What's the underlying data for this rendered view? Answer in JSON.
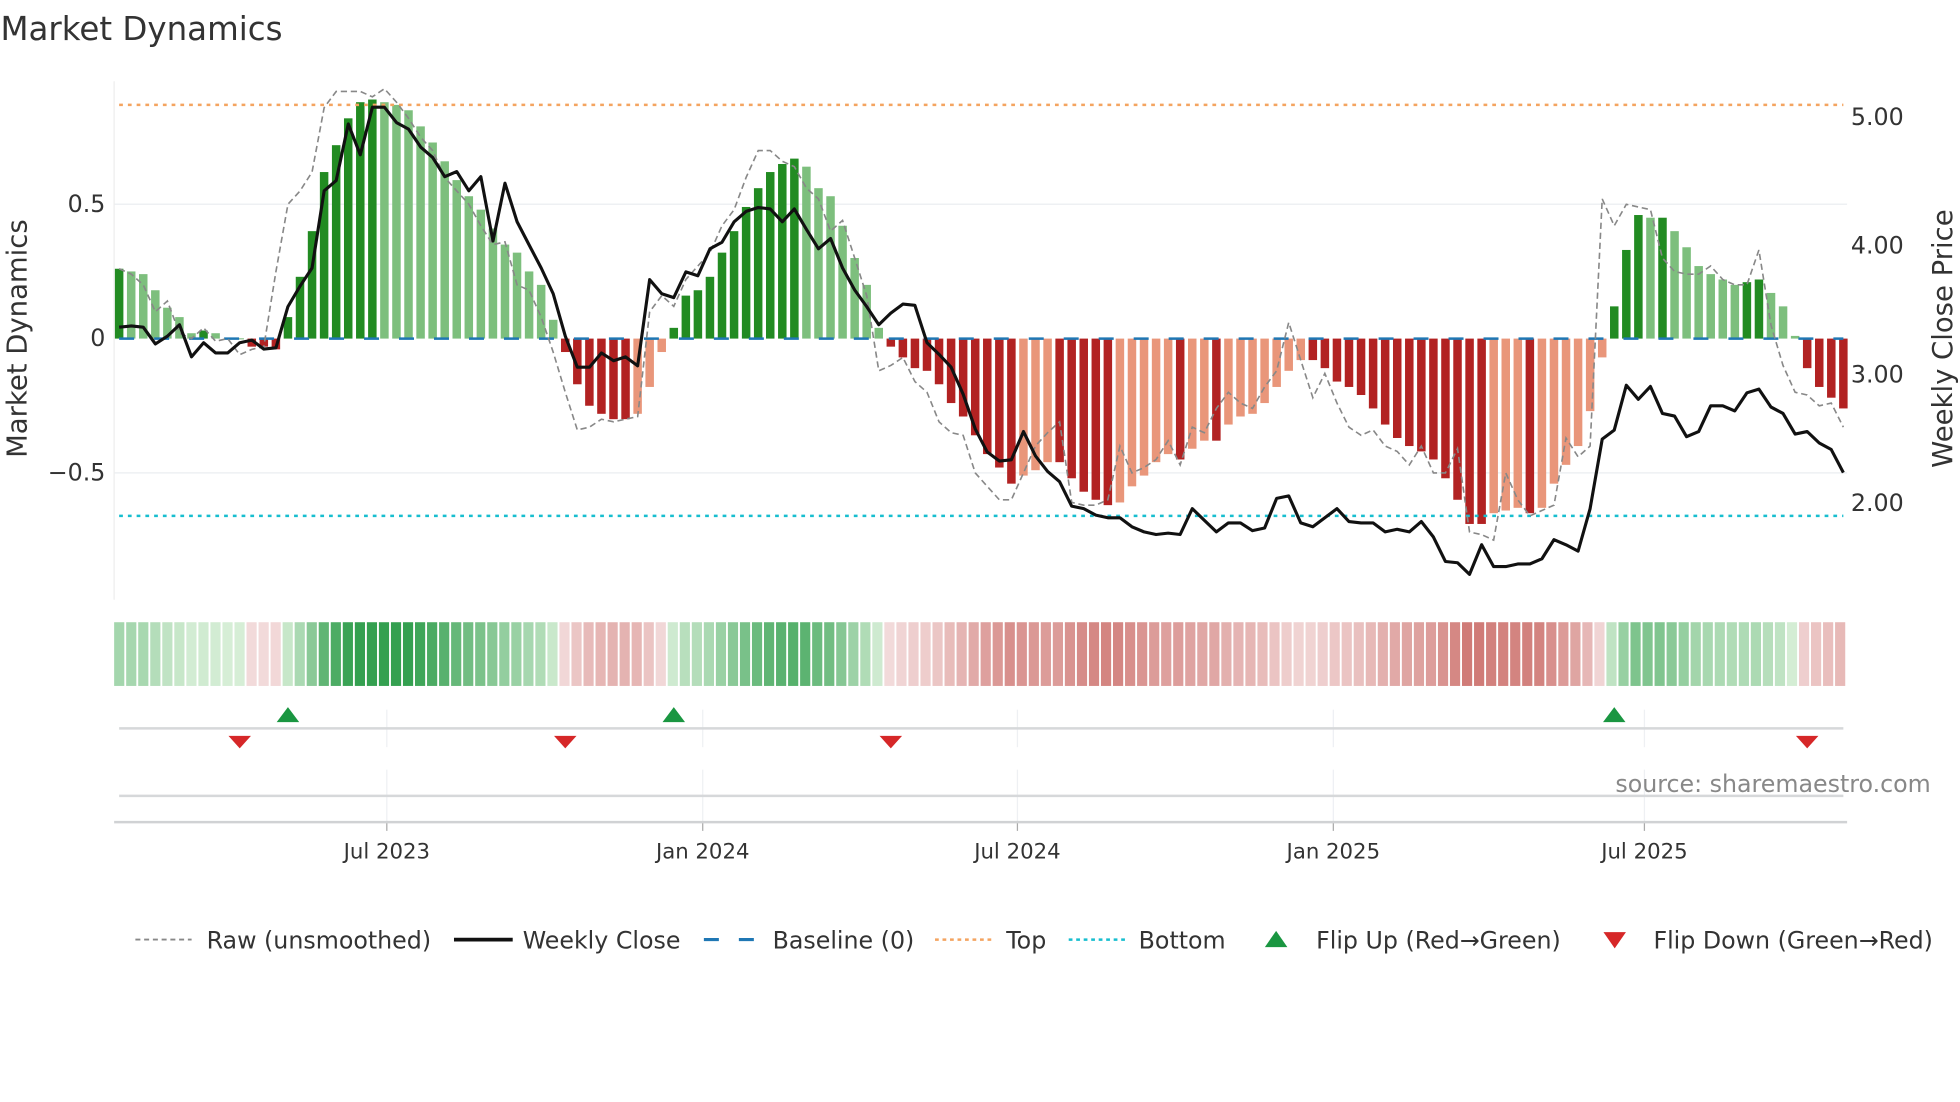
{
  "title": "Market Dynamics",
  "source": "source: sharemaestro.com",
  "colors": {
    "dark_green": "#228B22",
    "light_green": "#7DBF7D",
    "dark_red": "#B22222",
    "light_red": "#E9967A",
    "raw": "#888888",
    "close": "#111111",
    "baseline": "#1f77b4",
    "top": "#F4A460",
    "bottom": "#17BECF",
    "flip_up": "#1a9641",
    "flip_down": "#d62728"
  },
  "chart_data": {
    "type": "bar",
    "title": "Market Dynamics",
    "ylabel": "Market Dynamics",
    "y2label": "Weekly Close Price",
    "ylim": [
      -0.97,
      0.96
    ],
    "y2lim": [
      1.3,
      5.2
    ],
    "yticks": [
      {
        "value": 0.5,
        "label": "0.5"
      },
      {
        "value": 0,
        "label": "0"
      },
      {
        "value": -0.5,
        "label": "−0.5"
      }
    ],
    "y2ticks": [
      {
        "value": 5,
        "label": "5.00"
      },
      {
        "value": 4,
        "label": "4.00"
      },
      {
        "value": 3,
        "label": "3.00"
      },
      {
        "value": 2,
        "label": "2.00"
      }
    ],
    "xticks": [
      {
        "week": 22.2,
        "label": "Jul 2023"
      },
      {
        "week": 48.4,
        "label": "Jan 2024"
      },
      {
        "week": 74.5,
        "label": "Jul 2024"
      },
      {
        "week": 100.7,
        "label": "Jan 2025"
      },
      {
        "week": 126.5,
        "label": "Jul 2025"
      }
    ],
    "top_level": 0.87,
    "bottom_level": -0.66,
    "baseline": 0,
    "dynamics": [
      0.26,
      0.25,
      0.24,
      0.18,
      0.115,
      0.08,
      0.02,
      0.03,
      0.02,
      0.0,
      0.0,
      -0.03,
      -0.03,
      -0.04,
      0.08,
      0.23,
      0.4,
      0.62,
      0.72,
      0.82,
      0.88,
      0.89,
      0.88,
      0.87,
      0.85,
      0.79,
      0.73,
      0.66,
      0.59,
      0.53,
      0.48,
      0.41,
      0.35,
      0.32,
      0.25,
      0.2,
      0.07,
      -0.05,
      -0.17,
      -0.25,
      -0.28,
      -0.3,
      -0.3,
      -0.28,
      -0.18,
      -0.05,
      0.04,
      0.16,
      0.18,
      0.23,
      0.32,
      0.4,
      0.49,
      0.56,
      0.62,
      0.65,
      0.67,
      0.64,
      0.56,
      0.53,
      0.42,
      0.3,
      0.2,
      0.04,
      -0.03,
      -0.07,
      -0.11,
      -0.12,
      -0.17,
      -0.24,
      -0.29,
      -0.36,
      -0.43,
      -0.48,
      -0.54,
      -0.51,
      -0.49,
      -0.46,
      -0.46,
      -0.52,
      -0.57,
      -0.6,
      -0.62,
      -0.61,
      -0.55,
      -0.51,
      -0.46,
      -0.43,
      -0.45,
      -0.41,
      -0.38,
      -0.38,
      -0.32,
      -0.29,
      -0.28,
      -0.24,
      -0.18,
      -0.12,
      -0.08,
      -0.08,
      -0.11,
      -0.16,
      -0.18,
      -0.21,
      -0.26,
      -0.32,
      -0.37,
      -0.4,
      -0.42,
      -0.45,
      -0.52,
      -0.6,
      -0.69,
      -0.69,
      -0.65,
      -0.64,
      -0.63,
      -0.65,
      -0.63,
      -0.54,
      -0.47,
      -0.4,
      -0.27,
      -0.07,
      0.12,
      0.33,
      0.46,
      0.45,
      0.45,
      0.4,
      0.34,
      0.27,
      0.24,
      0.22,
      0.2,
      0.21,
      0.22,
      0.17,
      0.12,
      0.01,
      -0.11,
      -0.18,
      -0.22,
      -0.26
    ],
    "raw": [
      0.26,
      0.24,
      0.2,
      0.1,
      0.14,
      0.02,
      0.0,
      0.04,
      -0.01,
      0.0,
      -0.06,
      -0.04,
      -0.03,
      0.25,
      0.5,
      0.55,
      0.62,
      0.86,
      0.92,
      0.92,
      0.92,
      0.9,
      0.93,
      0.88,
      0.82,
      0.75,
      0.7,
      0.6,
      0.55,
      0.5,
      0.42,
      0.35,
      0.36,
      0.2,
      0.18,
      0.08,
      -0.05,
      -0.2,
      -0.34,
      -0.33,
      -0.3,
      -0.31,
      -0.3,
      -0.29,
      0.1,
      0.16,
      0.12,
      0.22,
      0.27,
      0.32,
      0.42,
      0.48,
      0.6,
      0.7,
      0.7,
      0.66,
      0.64,
      0.56,
      0.52,
      0.4,
      0.44,
      0.3,
      0.16,
      -0.12,
      -0.1,
      -0.07,
      -0.16,
      -0.2,
      -0.31,
      -0.35,
      -0.36,
      -0.5,
      -0.55,
      -0.6,
      -0.6,
      -0.5,
      -0.4,
      -0.35,
      -0.31,
      -0.61,
      -0.62,
      -0.62,
      -0.6,
      -0.4,
      -0.5,
      -0.48,
      -0.45,
      -0.38,
      -0.47,
      -0.33,
      -0.35,
      -0.26,
      -0.2,
      -0.24,
      -0.26,
      -0.18,
      -0.12,
      0.06,
      -0.08,
      -0.22,
      -0.13,
      -0.24,
      -0.33,
      -0.36,
      -0.34,
      -0.4,
      -0.42,
      -0.47,
      -0.4,
      -0.5,
      -0.5,
      -0.41,
      -0.72,
      -0.73,
      -0.75,
      -0.5,
      -0.6,
      -0.66,
      -0.64,
      -0.62,
      -0.37,
      -0.44,
      -0.4,
      0.52,
      0.42,
      0.5,
      0.49,
      0.48,
      0.3,
      0.25,
      0.24,
      0.24,
      0.27,
      0.22,
      0.2,
      0.2,
      0.33,
      0.05,
      -0.1,
      -0.2,
      -0.21,
      -0.25,
      -0.24,
      -0.33
    ],
    "close": [
      3.36,
      3.37,
      3.36,
      3.23,
      3.29,
      3.38,
      3.13,
      3.24,
      3.16,
      3.16,
      3.24,
      3.26,
      3.19,
      3.2,
      3.52,
      3.68,
      3.82,
      4.42,
      4.5,
      4.94,
      4.7,
      5.07,
      5.07,
      4.95,
      4.9,
      4.76,
      4.68,
      4.53,
      4.57,
      4.42,
      4.53,
      4.03,
      4.48,
      4.18,
      4.0,
      3.82,
      3.62,
      3.29,
      3.05,
      3.05,
      3.16,
      3.1,
      3.13,
      3.06,
      3.73,
      3.62,
      3.59,
      3.79,
      3.76,
      3.97,
      4.02,
      4.18,
      4.26,
      4.29,
      4.28,
      4.18,
      4.28,
      4.12,
      3.97,
      4.05,
      3.82,
      3.65,
      3.52,
      3.38,
      3.47,
      3.54,
      3.53,
      3.24,
      3.15,
      3.05,
      2.84,
      2.57,
      2.39,
      2.32,
      2.33,
      2.55,
      2.36,
      2.24,
      2.16,
      1.97,
      1.95,
      1.9,
      1.88,
      1.88,
      1.81,
      1.77,
      1.75,
      1.76,
      1.75,
      1.95,
      1.86,
      1.77,
      1.84,
      1.84,
      1.78,
      1.8,
      2.03,
      2.05,
      1.84,
      1.81,
      1.88,
      1.95,
      1.85,
      1.84,
      1.84,
      1.77,
      1.79,
      1.77,
      1.85,
      1.73,
      1.54,
      1.53,
      1.44,
      1.67,
      1.5,
      1.5,
      1.52,
      1.52,
      1.56,
      1.71,
      1.67,
      1.62,
      1.95,
      2.49,
      2.56,
      2.91,
      2.8,
      2.9,
      2.69,
      2.67,
      2.51,
      2.55,
      2.75,
      2.75,
      2.71,
      2.85,
      2.88,
      2.74,
      2.69,
      2.53,
      2.55,
      2.46,
      2.41,
      2.23
    ],
    "flip_up_weeks": [
      14,
      46,
      124
    ],
    "flip_down_weeks": [
      10,
      37,
      64,
      140
    ],
    "legend": {
      "position": "bottom",
      "items": [
        {
          "label": "Raw (unsmoothed)",
          "kind": "raw"
        },
        {
          "label": "Weekly Close",
          "kind": "close"
        },
        {
          "label": "Baseline (0)",
          "kind": "baseline"
        },
        {
          "label": "Top",
          "kind": "top"
        },
        {
          "label": "Bottom",
          "kind": "bottom"
        },
        {
          "label": "Flip Up (Red→Green)",
          "kind": "up"
        },
        {
          "label": "Flip Down (Green→Red)",
          "kind": "down"
        }
      ]
    }
  }
}
